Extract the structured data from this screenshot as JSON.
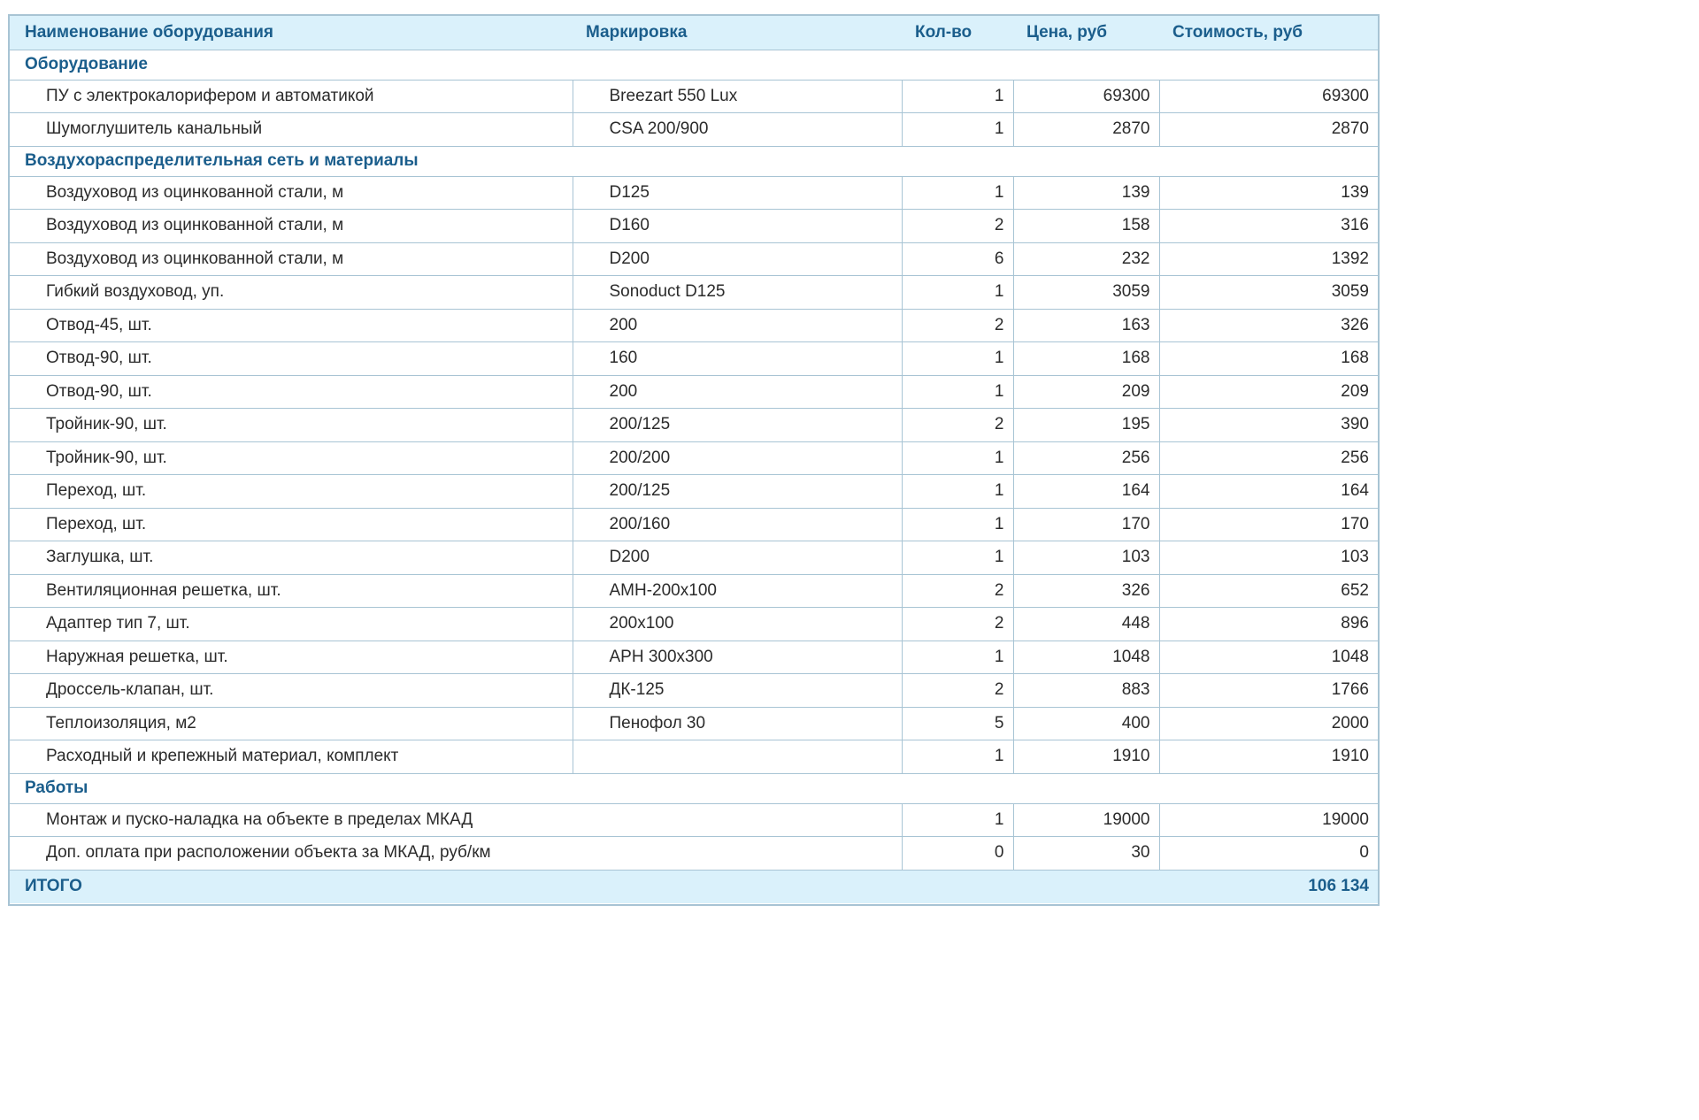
{
  "columns": {
    "name": "Наименование оборудования",
    "marking": "Маркировка",
    "qty": "Кол-во",
    "price": "Цена, руб",
    "cost": "Стоимость, руб"
  },
  "sections": [
    {
      "title": "Оборудование",
      "rows": [
        {
          "name": "ПУ с электрокалорифером и автоматикой",
          "marking": "Breezart 550 Lux",
          "qty": "1",
          "price": "69300",
          "cost": "69300"
        },
        {
          "name": "Шумоглушитель канальный",
          "marking": "CSA 200/900",
          "qty": "1",
          "price": "2870",
          "cost": "2870"
        }
      ]
    },
    {
      "title": "Воздухораспределительная сеть и материалы",
      "rows": [
        {
          "name": "Воздуховод из оцинкованной стали, м",
          "marking": "D125",
          "qty": "1",
          "price": "139",
          "cost": "139"
        },
        {
          "name": "Воздуховод из оцинкованной стали, м",
          "marking": "D160",
          "qty": "2",
          "price": "158",
          "cost": "316"
        },
        {
          "name": "Воздуховод из оцинкованной стали, м",
          "marking": "D200",
          "qty": "6",
          "price": "232",
          "cost": "1392"
        },
        {
          "name": "Гибкий воздуховод, уп.",
          "marking": "Sonoduct D125",
          "qty": "1",
          "price": "3059",
          "cost": "3059"
        },
        {
          "name": "Отвод-45, шт.",
          "marking": "200",
          "qty": "2",
          "price": "163",
          "cost": "326"
        },
        {
          "name": "Отвод-90, шт.",
          "marking": "160",
          "qty": "1",
          "price": "168",
          "cost": "168"
        },
        {
          "name": "Отвод-90, шт.",
          "marking": "200",
          "qty": "1",
          "price": "209",
          "cost": "209"
        },
        {
          "name": "Тройник-90, шт.",
          "marking": "200/125",
          "qty": "2",
          "price": "195",
          "cost": "390"
        },
        {
          "name": "Тройник-90, шт.",
          "marking": "200/200",
          "qty": "1",
          "price": "256",
          "cost": "256"
        },
        {
          "name": "Переход, шт.",
          "marking": "200/125",
          "qty": "1",
          "price": "164",
          "cost": "164"
        },
        {
          "name": "Переход, шт.",
          "marking": "200/160",
          "qty": "1",
          "price": "170",
          "cost": "170"
        },
        {
          "name": "Заглушка, шт.",
          "marking": "D200",
          "qty": "1",
          "price": "103",
          "cost": "103"
        },
        {
          "name": "Вентиляционная решетка, шт.",
          "marking": "АМН-200x100",
          "qty": "2",
          "price": "326",
          "cost": "652"
        },
        {
          "name": "Адаптер тип 7, шт.",
          "marking": "200x100",
          "qty": "2",
          "price": "448",
          "cost": "896"
        },
        {
          "name": "Наружная решетка, шт.",
          "marking": "АРН 300x300",
          "qty": "1",
          "price": "1048",
          "cost": "1048"
        },
        {
          "name": "Дроссель-клапан, шт.",
          "marking": "ДК-125",
          "qty": "2",
          "price": "883",
          "cost": "1766"
        },
        {
          "name": "Теплоизоляция, м2",
          "marking": "Пенофол 30",
          "qty": "5",
          "price": "400",
          "cost": "2000"
        },
        {
          "name": "Расходный и крепежный материал, комплект",
          "marking": "",
          "qty": "1",
          "price": "1910",
          "cost": "1910"
        }
      ]
    },
    {
      "title": "Работы",
      "merged": true,
      "rows": [
        {
          "name": "Монтаж и пуско-наладка на объекте в пределах МКАД",
          "qty": "1",
          "price": "19000",
          "cost": "19000"
        },
        {
          "name": "Доп. оплата при расположении объекта за МКАД, руб/км",
          "qty": "0",
          "price": "30",
          "cost": "0"
        }
      ]
    }
  ],
  "total": {
    "label": "ИТОГО",
    "value": "106 134"
  }
}
